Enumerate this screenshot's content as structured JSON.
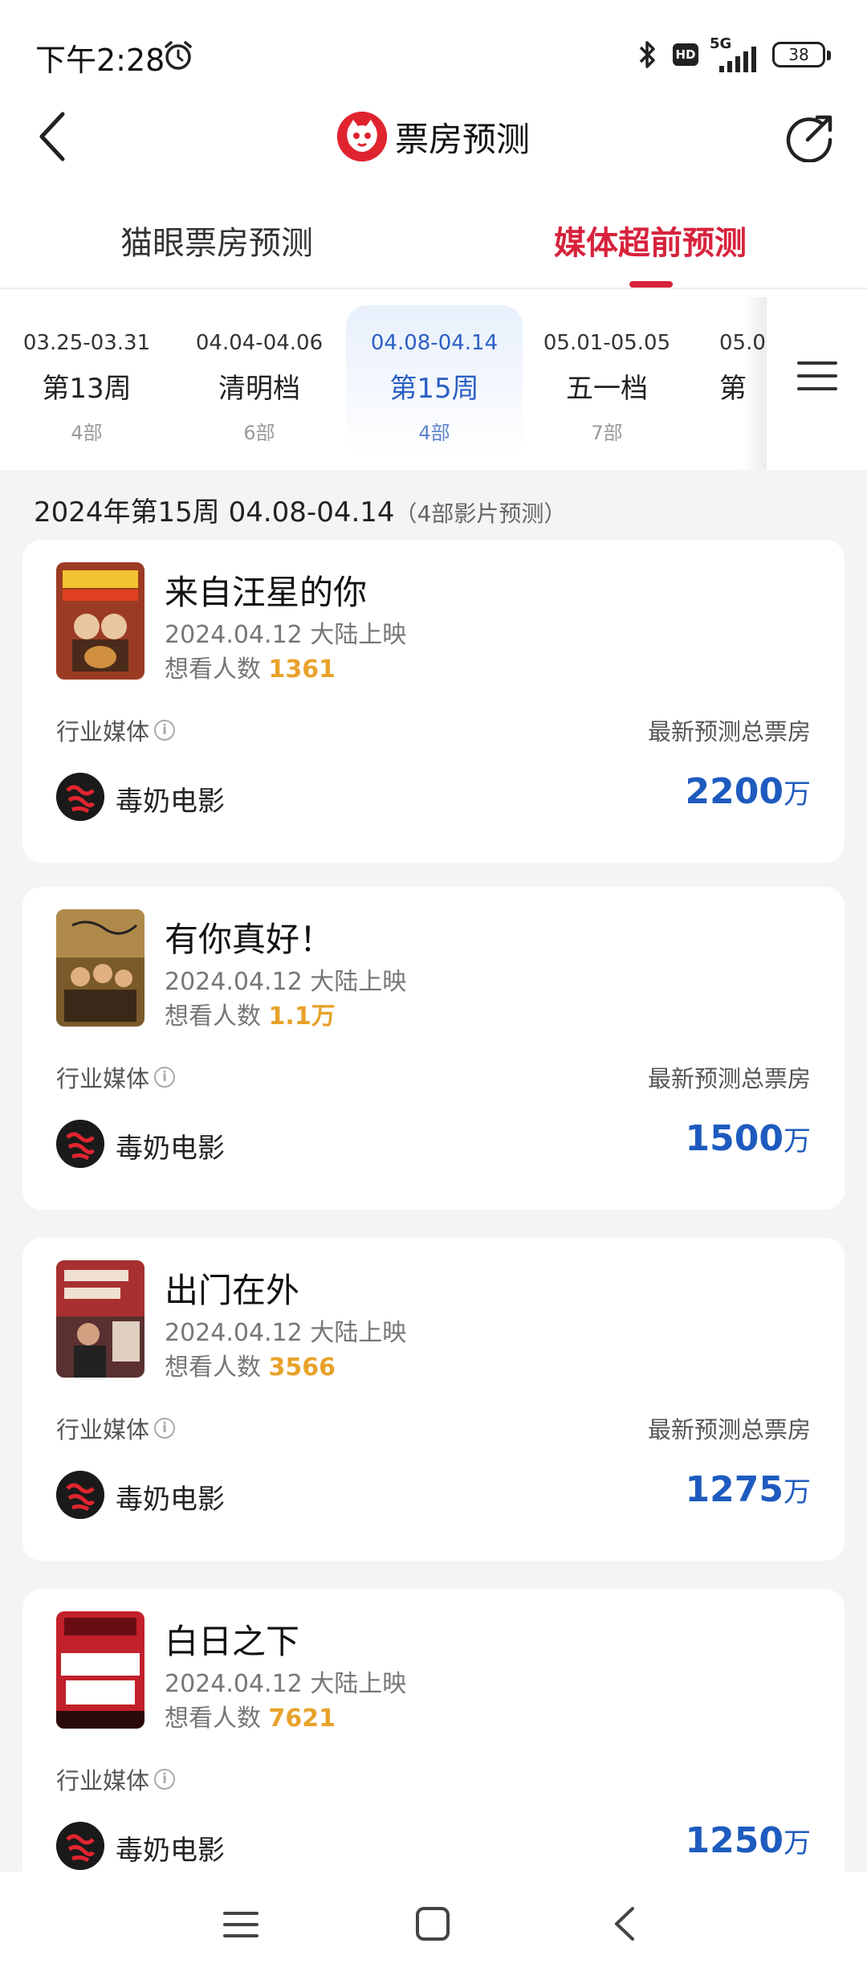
{
  "status_bar": {
    "time": "下午2:28",
    "battery": "38",
    "network": "5G",
    "hd": "HD"
  },
  "header": {
    "title": "票房预测"
  },
  "tabs": [
    {
      "label": "猫眼票房预测",
      "active": false
    },
    {
      "label": "媒体超前预测",
      "active": true
    }
  ],
  "weeks": [
    {
      "range": "03.25-03.31",
      "name": "第13周",
      "count": "4部"
    },
    {
      "range": "04.04-04.06",
      "name": "清明档",
      "count": "6部"
    },
    {
      "range": "04.08-04.14",
      "name": "第15周",
      "count": "4部",
      "active": true
    },
    {
      "range": "05.01-05.05",
      "name": "五一档",
      "count": "7部"
    },
    {
      "range": "05.0",
      "name": "第",
      "count": ""
    }
  ],
  "section": {
    "title": "2024年第15周 04.08-04.14",
    "subtitle": "（4部影片预测）"
  },
  "labels": {
    "media": "行业媒体",
    "forecast": "最新预测总票房",
    "want_prefix": "想看人数"
  },
  "films": [
    {
      "title": "来自汪星的你",
      "date": "2024.04.12 大陆上映",
      "want": "1361",
      "source": "毒奶电影",
      "value": "2200",
      "unit": "万",
      "poster_color": "#9c3b24"
    },
    {
      "title": "有你真好！",
      "date": "2024.04.12 大陆上映",
      "want": "1.1万",
      "source": "毒奶电影",
      "value": "1500",
      "unit": "万",
      "poster_color": "#7a5a2a"
    },
    {
      "title": "出门在外",
      "date": "2024.04.12 大陆上映",
      "want": "3566",
      "source": "毒奶电影",
      "value": "1275",
      "unit": "万",
      "poster_color": "#5a3030"
    },
    {
      "title": "白日之下",
      "date": "2024.04.12 大陆上映",
      "want": "7621",
      "source": "毒奶电影",
      "value": "1250",
      "unit": "万",
      "poster_color": "#c2202a"
    }
  ]
}
